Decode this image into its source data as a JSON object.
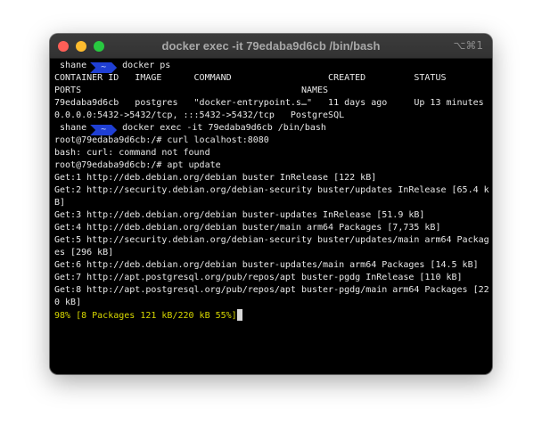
{
  "window": {
    "title": "docker exec -it 79edaba9d6cb /bin/bash",
    "shortcut": "⌥⌘1",
    "traffic_lights": {
      "close": "#fe5f57",
      "minimize": "#febc2e",
      "zoom": "#28c840"
    }
  },
  "prompt": {
    "user": "shane",
    "dir": "~",
    "color": "#1f3fd4"
  },
  "commands": {
    "ps": "docker ps",
    "exec": "docker exec -it 79edaba9d6cb /bin/bash"
  },
  "output": [
    "CONTAINER ID   IMAGE      COMMAND                  CREATED         STATUS",
    "PORTS                                         NAMES",
    "79edaba9d6cb   postgres   \"docker-entrypoint.s…\"   11 days ago     Up 13 minutes",
    "0.0.0.0:5432->5432/tcp, :::5432->5432/tcp   PostgreSQL"
  ],
  "container_output": [
    "root@79edaba9d6cb:/# curl localhost:8080",
    "bash: curl: command not found",
    "root@79edaba9d6cb:/# apt update",
    "Get:1 http://deb.debian.org/debian buster InRelease [122 kB]",
    "Get:2 http://security.debian.org/debian-security buster/updates InRelease [65.4 k",
    "B]",
    "Get:3 http://deb.debian.org/debian buster-updates InRelease [51.9 kB]",
    "Get:4 http://deb.debian.org/debian buster/main arm64 Packages [7,735 kB]",
    "Get:5 http://security.debian.org/debian-security buster/updates/main arm64 Packag",
    "es [296 kB]",
    "Get:6 http://deb.debian.org/debian buster-updates/main arm64 Packages [14.5 kB]",
    "Get:7 http://apt.postgresql.org/pub/repos/apt buster-pgdg InRelease [110 kB]",
    "Get:8 http://apt.postgresql.org/pub/repos/apt buster-pgdg/main arm64 Packages [22",
    "0 kB]"
  ],
  "progress_line": "98% [8 Packages 121 kB/220 kB 55%]"
}
